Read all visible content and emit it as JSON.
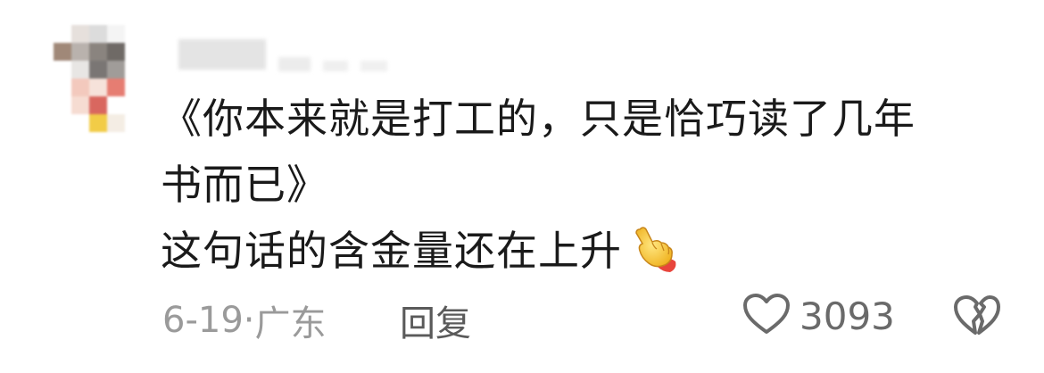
{
  "comment": {
    "text_line1": "《你本来就是打工的，只是恰巧读了几年",
    "text_line2": "书而已》",
    "text_line3": "这句话的含金量还在上升",
    "emoji_icon": "pointing-hand-icon",
    "date": "6-19",
    "separator": "·",
    "location": "广东",
    "reply_label": "回复",
    "like_count": "3093",
    "like_icon": "heart-outline-icon",
    "dislike_icon": "broken-heart-icon"
  },
  "colors": {
    "text": "#1a1a1a",
    "meta": "#9a9a9a",
    "icon": "#6a6a6a"
  }
}
